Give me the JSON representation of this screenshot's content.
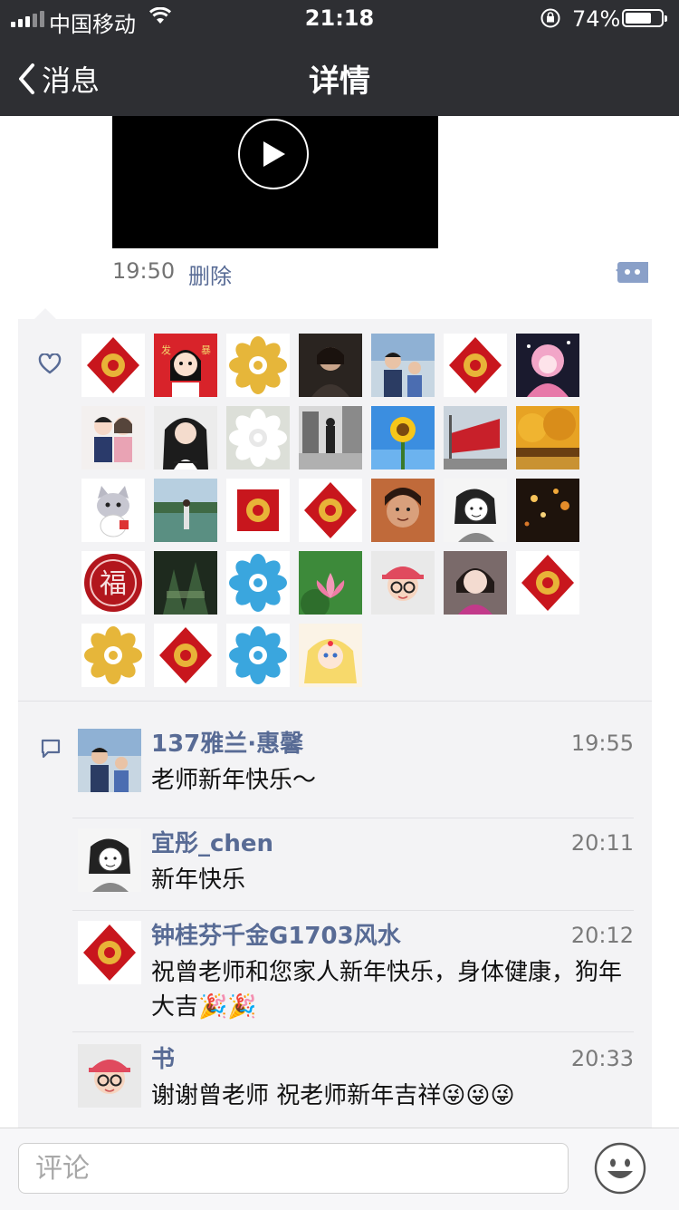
{
  "status_bar": {
    "carrier": "中国移动",
    "time": "21:18",
    "battery_percent": "74%",
    "battery_level": 0.74
  },
  "nav": {
    "back_label": "消息",
    "title": "详情"
  },
  "post": {
    "time": "19:50",
    "delete_label": "删除"
  },
  "likes": {
    "icon": "heart-icon",
    "avatars": [
      {
        "kind": "fu-diamond"
      },
      {
        "kind": "cartoon-girl"
      },
      {
        "kind": "gold-flower"
      },
      {
        "kind": "photo-dark"
      },
      {
        "kind": "photo-couple"
      },
      {
        "kind": "fu-diamond"
      },
      {
        "kind": "anime-pink"
      },
      {
        "kind": "cartoon-couple"
      },
      {
        "kind": "photo-woman"
      },
      {
        "kind": "white-flower"
      },
      {
        "kind": "photo-street"
      },
      {
        "kind": "sunflower"
      },
      {
        "kind": "red-flag"
      },
      {
        "kind": "autumn-trees"
      },
      {
        "kind": "cartoon-cat"
      },
      {
        "kind": "photo-lake"
      },
      {
        "kind": "gold-flower-square"
      },
      {
        "kind": "fu-diamond"
      },
      {
        "kind": "photo-face"
      },
      {
        "kind": "sketch-face"
      },
      {
        "kind": "photo-night"
      },
      {
        "kind": "fu-round"
      },
      {
        "kind": "photo-forest"
      },
      {
        "kind": "blue-flower"
      },
      {
        "kind": "lotus"
      },
      {
        "kind": "girl-cap"
      },
      {
        "kind": "photo-woman-2"
      },
      {
        "kind": "fu-diamond"
      },
      {
        "kind": "gold-flower"
      },
      {
        "kind": "fu-diamond"
      },
      {
        "kind": "blue-flower"
      },
      {
        "kind": "anime-sailor"
      }
    ]
  },
  "comments": [
    {
      "name": "137雅兰·惠馨",
      "time": "19:55",
      "text": "老师新年快乐～",
      "avatar": "photo-couple"
    },
    {
      "name": "宜彤_chen",
      "time": "20:11",
      "text": "新年快乐",
      "avatar": "sketch-face"
    },
    {
      "name": "钟桂芬千金G1703风水",
      "time": "20:12",
      "text": "祝曾老师和您家人新年快乐，身体健康，狗年大吉🎉🎉",
      "avatar": "fu-diamond"
    },
    {
      "name": "书",
      "time": "20:33",
      "text": "谢谢曾老师 祝老师新年吉祥😜😜😜",
      "avatar": "girl-cap"
    }
  ],
  "bottom": {
    "comment_placeholder": "评论"
  },
  "colors": {
    "bar_bg": "#2e2f33",
    "name_color": "#586b95",
    "panel_bg": "#f3f3f5"
  }
}
